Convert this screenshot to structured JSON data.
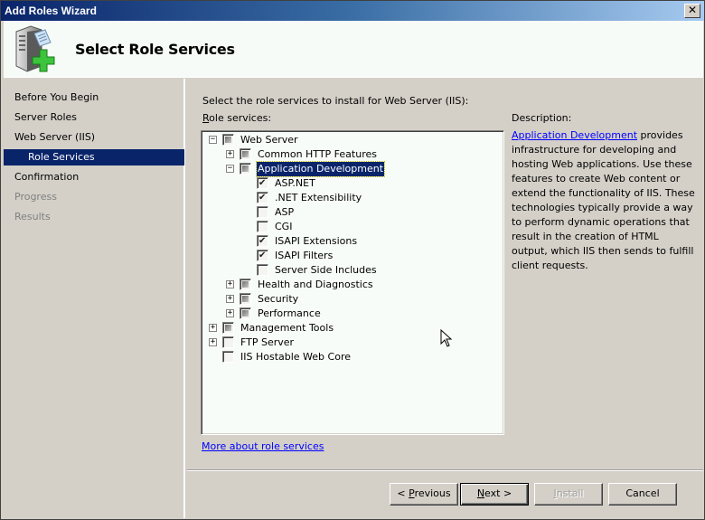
{
  "window": {
    "title": "Add Roles Wizard",
    "close_label": "✕"
  },
  "header": {
    "title": "Select Role Services",
    "icon": "server-add-icon"
  },
  "nav": {
    "items": [
      {
        "label": "Before You Begin",
        "state": "normal"
      },
      {
        "label": "Server Roles",
        "state": "normal"
      },
      {
        "label": "Web Server (IIS)",
        "state": "normal"
      },
      {
        "label": "Role Services",
        "state": "active"
      },
      {
        "label": "Confirmation",
        "state": "normal"
      },
      {
        "label": "Progress",
        "state": "disabled"
      },
      {
        "label": "Results",
        "state": "disabled"
      }
    ]
  },
  "content": {
    "instruction": "Select the role services to install for Web Server (IIS):",
    "role_services_label_accel": "R",
    "role_services_label_rest": "ole services:",
    "tree": [
      {
        "label": "Web Server",
        "level": 0,
        "expander": "minus",
        "check": "indeterminate"
      },
      {
        "label": "Common HTTP Features",
        "level": 1,
        "expander": "plus",
        "check": "indeterminate"
      },
      {
        "label": "Application Development",
        "level": 1,
        "expander": "minus",
        "check": "indeterminate",
        "selected": true
      },
      {
        "label": "ASP.NET",
        "level": 2,
        "expander": "none",
        "check": "checked"
      },
      {
        "label": ".NET Extensibility",
        "level": 2,
        "expander": "none",
        "check": "checked"
      },
      {
        "label": "ASP",
        "level": 2,
        "expander": "none",
        "check": "unchecked"
      },
      {
        "label": "CGI",
        "level": 2,
        "expander": "none",
        "check": "unchecked"
      },
      {
        "label": "ISAPI Extensions",
        "level": 2,
        "expander": "none",
        "check": "checked"
      },
      {
        "label": "ISAPI Filters",
        "level": 2,
        "expander": "none",
        "check": "checked"
      },
      {
        "label": "Server Side Includes",
        "level": 2,
        "expander": "none",
        "check": "unchecked"
      },
      {
        "label": "Health and Diagnostics",
        "level": 1,
        "expander": "plus",
        "check": "indeterminate"
      },
      {
        "label": "Security",
        "level": 1,
        "expander": "plus",
        "check": "indeterminate"
      },
      {
        "label": "Performance",
        "level": 1,
        "expander": "plus",
        "check": "indeterminate"
      },
      {
        "label": "Management Tools",
        "level": 0,
        "expander": "plus",
        "check": "indeterminate"
      },
      {
        "label": "FTP Server",
        "level": 0,
        "expander": "plus",
        "check": "unchecked"
      },
      {
        "label": "IIS Hostable Web Core",
        "level": 0,
        "expander": "none",
        "check": "unchecked"
      }
    ],
    "description_heading": "Description:",
    "description_link": "Application Development",
    "description_text": " provides infrastructure for developing and hosting Web applications. Use these features to create Web content or extend the functionality of IIS. These technologies typically provide a way to perform dynamic operations that result in the creation of HTML output, which IIS then sends to fulfill client requests.",
    "more_link": "More about role services"
  },
  "buttons": {
    "previous": {
      "prefix": "< ",
      "accel": "P",
      "rest": "revious"
    },
    "next": {
      "prefix": "",
      "accel": "N",
      "rest": "ext >"
    },
    "install": {
      "prefix": "",
      "accel": "I",
      "rest": "nstall"
    },
    "cancel": {
      "label": "Cancel"
    }
  },
  "colors": {
    "selection": "#0a246a",
    "link": "#0000ff",
    "face": "#d4d0c8"
  }
}
